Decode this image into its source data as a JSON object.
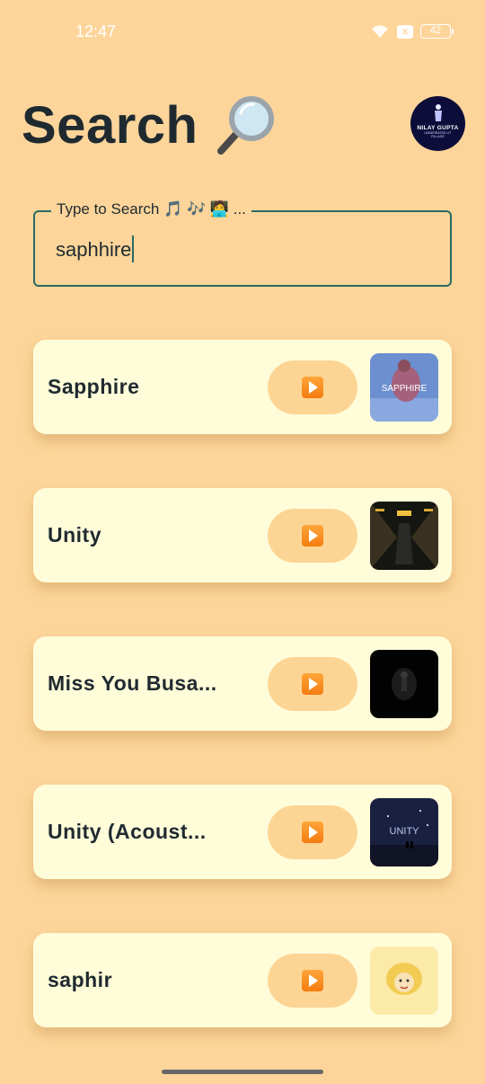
{
  "status_bar": {
    "time": "12:47",
    "battery": "42",
    "notification_badge": "x"
  },
  "header": {
    "title": "Search",
    "title_emoji_icon": "magnifying-glass-icon"
  },
  "avatar": {
    "name": "NILAY GUPTA",
    "tagline": "UNDERRATED LIT PILLAGE"
  },
  "search": {
    "label": "Type to Search 🎵 🎶 🧑‍💻 ...",
    "value": "saphhire"
  },
  "results": [
    {
      "title": "Sapphire",
      "play_icon": "play-button-icon",
      "thumb_colors": [
        "#5e86c9",
        "#a06a8c"
      ]
    },
    {
      "title": "Unity",
      "play_icon": "play-button-icon",
      "thumb_colors": [
        "#1a1a18",
        "#c99c2e"
      ]
    },
    {
      "title": "Miss You Busa...",
      "play_icon": "play-button-icon",
      "thumb_colors": [
        "#000000",
        "#2a2a2a"
      ]
    },
    {
      "title": "Unity (Acoust...",
      "play_icon": "play-button-icon",
      "thumb_colors": [
        "#1b2340",
        "#8aa3d8"
      ]
    },
    {
      "title": "saphir",
      "play_icon": "play-button-icon",
      "thumb_colors": [
        "#fbe6a0",
        "#e8c25a"
      ]
    }
  ],
  "colors": {
    "background": "#fdd59a",
    "card": "#fffcd9",
    "accent": "#2b6a62",
    "play_bg": "#fcd594"
  }
}
